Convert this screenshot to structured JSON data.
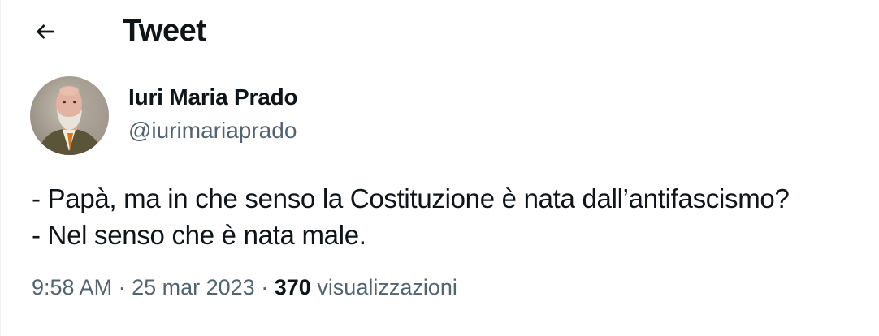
{
  "header": {
    "back_icon": "arrow-left-icon",
    "title": "Tweet"
  },
  "author": {
    "display_name": "Iuri Maria Prado",
    "handle": "@iurimariaprado",
    "avatar_icon": "profile-photo"
  },
  "tweet": {
    "lines": [
      "- Papà, ma in che senso la Costituzione è nata dall’antifascismo?",
      "- Nel senso che è nata male."
    ]
  },
  "meta": {
    "time": "9:58 AM",
    "separator": "·",
    "date": "25 mar 2023",
    "views_count": "370",
    "views_label": "visualizzazioni"
  },
  "colors": {
    "text_primary": "#0f1419",
    "text_secondary": "#536471",
    "divider": "#eff3f4"
  }
}
